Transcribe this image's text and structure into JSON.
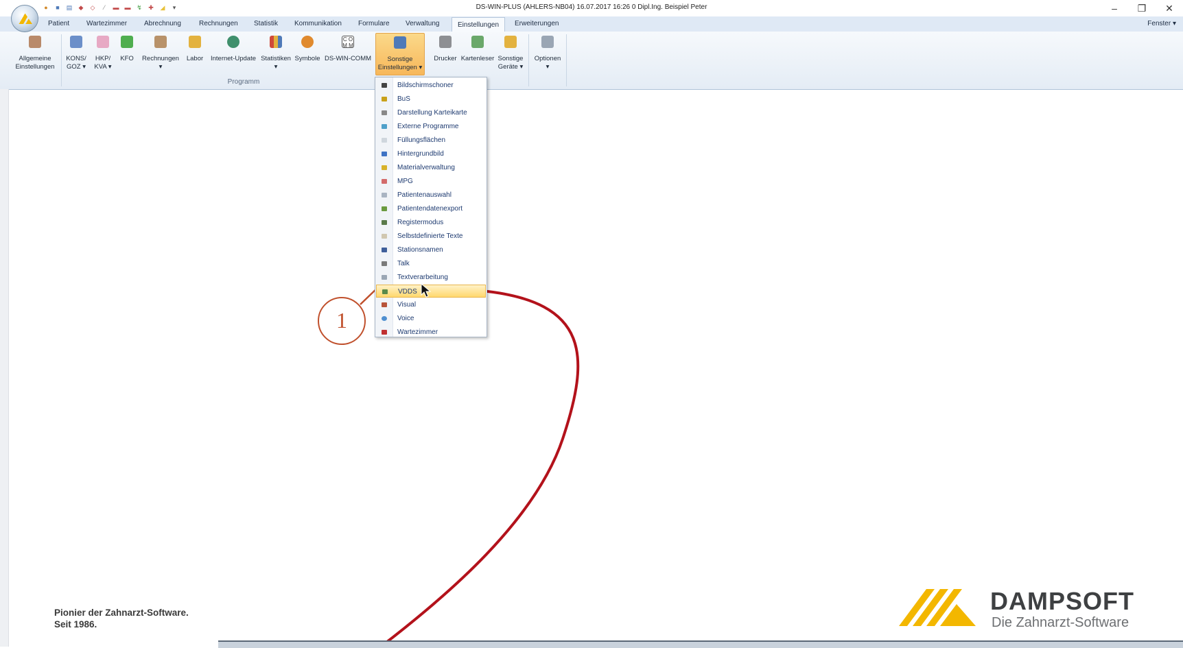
{
  "window": {
    "title": "DS-WIN-PLUS (AHLERS-NB04)   16.07.2017   16:26  0  Dipl.Ing.  Beispiel  Peter",
    "controls": [
      "–",
      "❐",
      "✕"
    ]
  },
  "tabs": [
    "Patient",
    "Wartezimmer",
    "Abrechnung",
    "Rechnungen",
    "Statistik",
    "Kommunikation",
    "Formulare",
    "Verwaltung",
    "Einstellungen",
    "Erweiterungen"
  ],
  "active_tab": "Einstellungen",
  "fenster_label": "Fenster ▾",
  "ribbon": {
    "buttons": [
      {
        "l1": "Allgemeine",
        "l2": "Einstellungen"
      },
      {
        "l1": "KONS/",
        "l2": "GOZ ▾"
      },
      {
        "l1": "HKP/",
        "l2": "KVA ▾"
      },
      {
        "l1": "KFO",
        "l2": ""
      },
      {
        "l1": "Rechnungen",
        "l2": "▾"
      },
      {
        "l1": "Labor",
        "l2": ""
      },
      {
        "l1": "Internet-Update",
        "l2": ""
      },
      {
        "l1": "Statistiken",
        "l2": "▾"
      },
      {
        "l1": "Symbole",
        "l2": ""
      },
      {
        "l1": "DS-WIN-COMM",
        "l2": ""
      },
      {
        "l1": "Sonstige",
        "l2": "Einstellungen ▾"
      },
      {
        "l1": "Drucker",
        "l2": ""
      },
      {
        "l1": "Kartenleser",
        "l2": ""
      },
      {
        "l1": "Sonstige",
        "l2": "Geräte ▾"
      },
      {
        "l1": "Optionen",
        "l2": "▾"
      }
    ],
    "group_label": "Programm"
  },
  "menu": {
    "items": [
      "Bildschirmschoner",
      "BuS",
      "Darstellung Karteikarte",
      "Externe Programme",
      "Füllungsflächen",
      "Hintergrundbild",
      "Materialverwaltung",
      "MPG",
      "Patientenauswahl",
      "Patientendatenexport",
      "Registermodus",
      "Selbstdefinierte Texte",
      "Stationsnamen",
      "Talk",
      "Textverarbeitung",
      "VDDS",
      "Visual",
      "Voice",
      "Wartezimmer"
    ],
    "selected": "VDDS"
  },
  "callout_number": "1",
  "footer": {
    "slogan_line1": "Pionier der Zahnarzt-Software.",
    "slogan_line2": "Seit 1986.",
    "brand_name": "DAMPSOFT",
    "brand_tagline": "Die Zahnarzt-Software"
  },
  "colors": {
    "accent_orange": "#f7b75a",
    "annotation_red": "#b3121b",
    "callout_orange": "#c0502c",
    "brand_yellow": "#f3b700"
  }
}
